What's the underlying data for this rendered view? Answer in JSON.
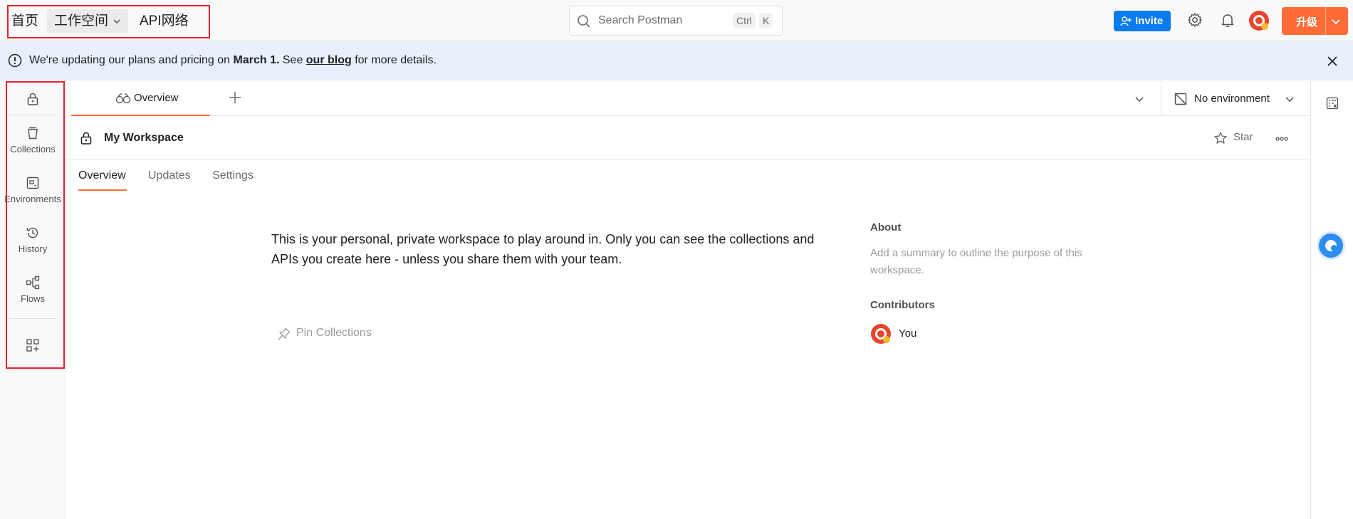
{
  "topbar": {
    "nav": {
      "home": "首页",
      "workspace": "工作空间",
      "api_network": "API网络"
    },
    "search": {
      "placeholder": "Search Postman",
      "shortcut_ctrl": "Ctrl",
      "shortcut_key": "K"
    },
    "invite_label": "Invite",
    "upgrade_label": "升级"
  },
  "banner": {
    "text_before": "We're updating our plans and pricing on ",
    "date": "March 1.",
    "text_mid": " See ",
    "link": "our blog",
    "text_after": " for more details."
  },
  "sidebar": {
    "items": [
      {
        "icon": "lock-icon",
        "label": ""
      },
      {
        "icon": "collections-icon",
        "label": "Collections"
      },
      {
        "icon": "environments-icon",
        "label": "Environments"
      },
      {
        "icon": "history-icon",
        "label": "History"
      },
      {
        "icon": "flows-icon",
        "label": "Flows"
      },
      {
        "icon": "add-apps-icon",
        "label": ""
      }
    ]
  },
  "tabs": {
    "active_label": "Overview",
    "environment_label": "No environment"
  },
  "workspace": {
    "title": "My Workspace",
    "star_label": "Star",
    "subtabs": [
      "Overview",
      "Updates",
      "Settings"
    ],
    "active_subtab": "Overview",
    "description": "This is your personal, private workspace to play around in. Only you can see the collections and APIs you create here - unless you share them with your team.",
    "pin_label": "Pin Collections",
    "about_title": "About",
    "about_text": "Add a summary to outline the purpose of this workspace.",
    "contributors_title": "Contributors",
    "contributors": [
      "You"
    ]
  },
  "colors": {
    "accent": "#ff6c37",
    "primary_blue": "#097bed",
    "banner_bg": "#e7f0fb",
    "highlight_box": "#e8202a"
  }
}
